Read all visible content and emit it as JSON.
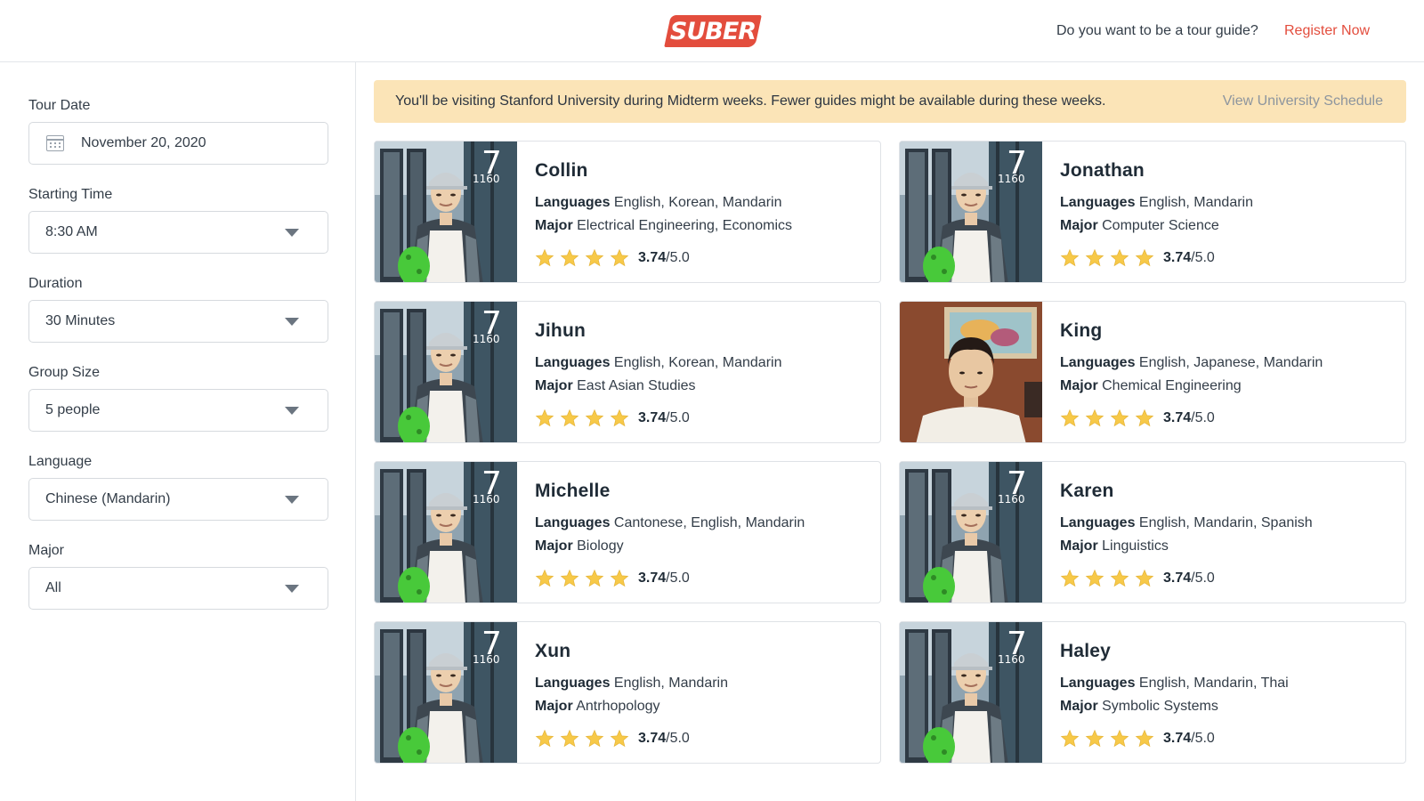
{
  "header": {
    "logo_text": "SUBER",
    "guide_question": "Do you want to be a tour guide?",
    "register_label": "Register Now"
  },
  "filters": {
    "tour_date": {
      "label": "Tour Date",
      "value": "November 20, 2020"
    },
    "starting_time": {
      "label": "Starting Time",
      "value": "8:30 AM"
    },
    "duration": {
      "label": "Duration",
      "value": "30 Minutes"
    },
    "group_size": {
      "label": "Group Size",
      "value": "5 people"
    },
    "language": {
      "label": "Language",
      "value": "Chinese (Mandarin)"
    },
    "major": {
      "label": "Major",
      "value": "All"
    }
  },
  "banner": {
    "message": "You'll be visiting Stanford University during Midterm weeks. Fewer guides might be available during these weeks.",
    "link_label": "View University Schedule"
  },
  "labels": {
    "languages": "Languages",
    "major": "Major",
    "rating_max": "/5.0"
  },
  "colors": {
    "brand": "#e34d3d",
    "banner_bg": "#fbe4b7",
    "star": "#f7c948"
  },
  "photo_caption_number": "1160",
  "guides": [
    {
      "name": "Collin",
      "languages": "English, Korean, Mandarin",
      "major": "Electrical Engineering, Economics",
      "rating": "3.74",
      "stars": 4,
      "photo": "campus"
    },
    {
      "name": "Jonathan",
      "languages": "English, Mandarin",
      "major": "Computer Science",
      "rating": "3.74",
      "stars": 4,
      "photo": "campus"
    },
    {
      "name": "Jihun",
      "languages": "English, Korean, Mandarin",
      "major": "East Asian Studies",
      "rating": "3.74",
      "stars": 4,
      "photo": "campus"
    },
    {
      "name": "King",
      "languages": "English, Japanese, Mandarin",
      "major": "Chemical Engineering",
      "rating": "3.74",
      "stars": 4,
      "photo": "indoor"
    },
    {
      "name": "Michelle",
      "languages": "Cantonese, English, Mandarin",
      "major": "Biology",
      "rating": "3.74",
      "stars": 4,
      "photo": "campus"
    },
    {
      "name": "Karen",
      "languages": "English, Mandarin, Spanish",
      "major": "Linguistics",
      "rating": "3.74",
      "stars": 4,
      "photo": "campus"
    },
    {
      "name": "Xun",
      "languages": "English, Mandarin",
      "major": "Antrhopology",
      "rating": "3.74",
      "stars": 4,
      "photo": "campus"
    },
    {
      "name": "Haley",
      "languages": "English, Mandarin, Thai",
      "major": "Symbolic Systems",
      "rating": "3.74",
      "stars": 4,
      "photo": "campus"
    }
  ]
}
